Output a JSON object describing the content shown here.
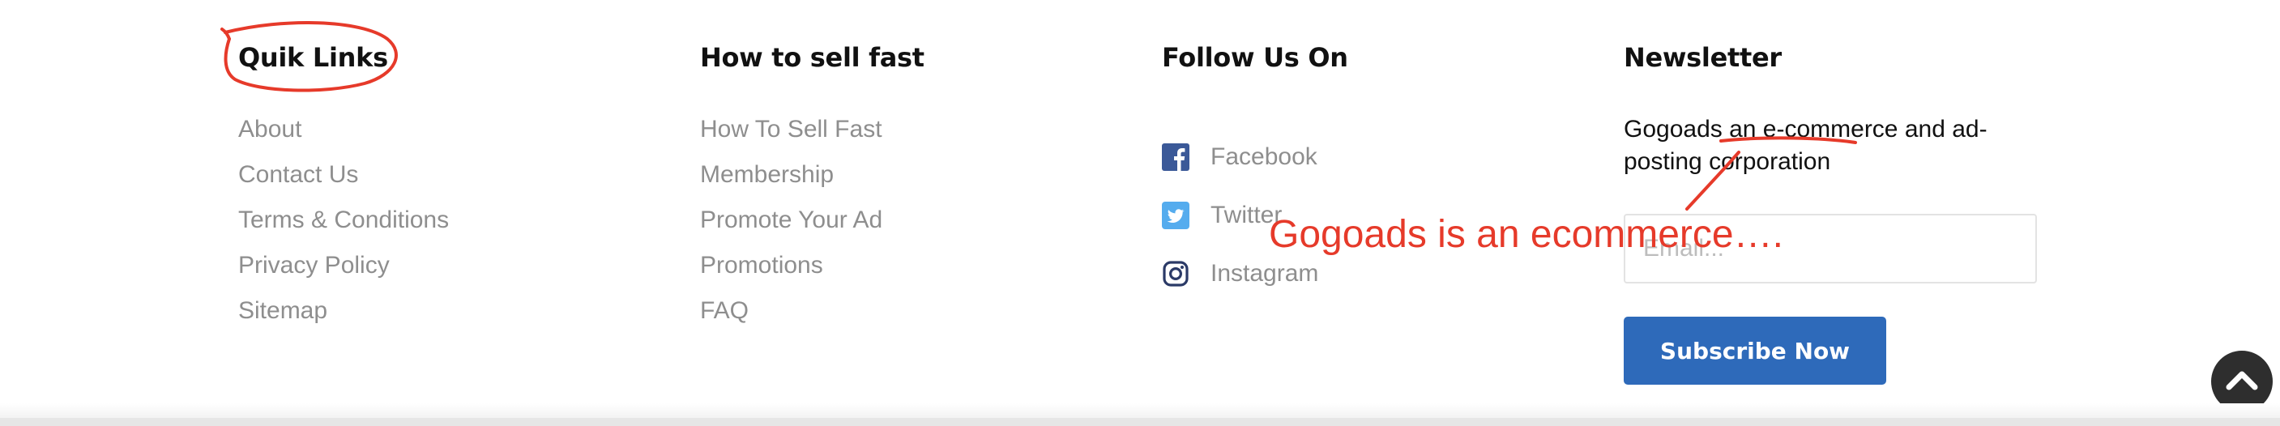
{
  "columns": {
    "quick_links": {
      "title": "Quik Links",
      "items": [
        {
          "label": "About"
        },
        {
          "label": "Contact Us"
        },
        {
          "label": "Terms & Conditions"
        },
        {
          "label": "Privacy Policy"
        },
        {
          "label": "Sitemap"
        }
      ]
    },
    "how_to_sell": {
      "title": "How to sell fast",
      "items": [
        {
          "label": "How To Sell Fast"
        },
        {
          "label": "Membership"
        },
        {
          "label": "Promote Your Ad"
        },
        {
          "label": "Promotions"
        },
        {
          "label": "FAQ"
        }
      ]
    },
    "follow": {
      "title": "Follow Us On",
      "items": [
        {
          "label": "Facebook",
          "icon": "facebook-icon",
          "color": "#3b5998"
        },
        {
          "label": "Twitter",
          "icon": "twitter-icon",
          "color": "#55acee"
        },
        {
          "label": "Instagram",
          "icon": "instagram-icon",
          "color": "#2b3a67"
        }
      ]
    },
    "newsletter": {
      "title": "Newsletter",
      "description": "Gogoads an e-commerce and ad-posting corporation",
      "email_placeholder": "Email...",
      "subscribe_label": "Subscribe Now"
    }
  },
  "back_to_top": {
    "icon": "chevron-up-icon"
  },
  "annotation": {
    "note": "Gogoads is an ecommerce….",
    "color": "#e63a2a"
  },
  "colors": {
    "accent": "#2e6aba",
    "link": "#8e8e8e",
    "heading": "#111111"
  }
}
